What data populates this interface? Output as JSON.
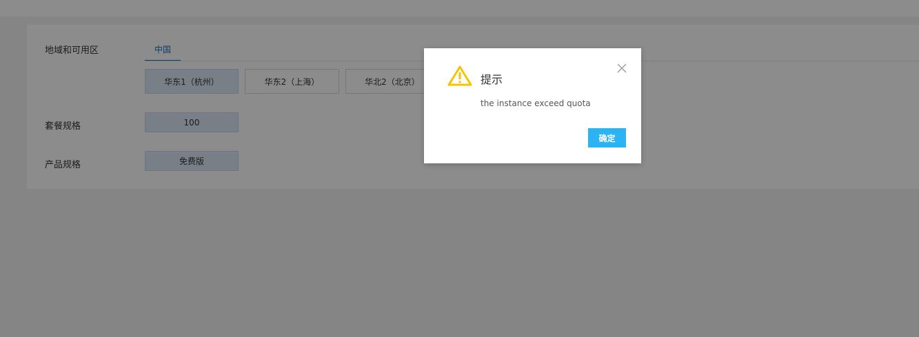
{
  "form": {
    "region_label": "地域和可用区",
    "region_tab": "中国",
    "zones": [
      "华东1（杭州）",
      "华东2（上海）",
      "华北2（北京）"
    ],
    "package_label": "套餐规格",
    "package_value": "100",
    "product_label": "产品规格",
    "product_value": "免费版"
  },
  "dialog": {
    "icon": "warning-triangle-icon",
    "title": "提示",
    "message": "the instance exceed quota",
    "confirm_label": "确定",
    "close_icon": "close-icon"
  },
  "colors": {
    "accent": "#2bb3f3",
    "warning": "#f5c400",
    "tab_blue": "#0f6cbd"
  }
}
